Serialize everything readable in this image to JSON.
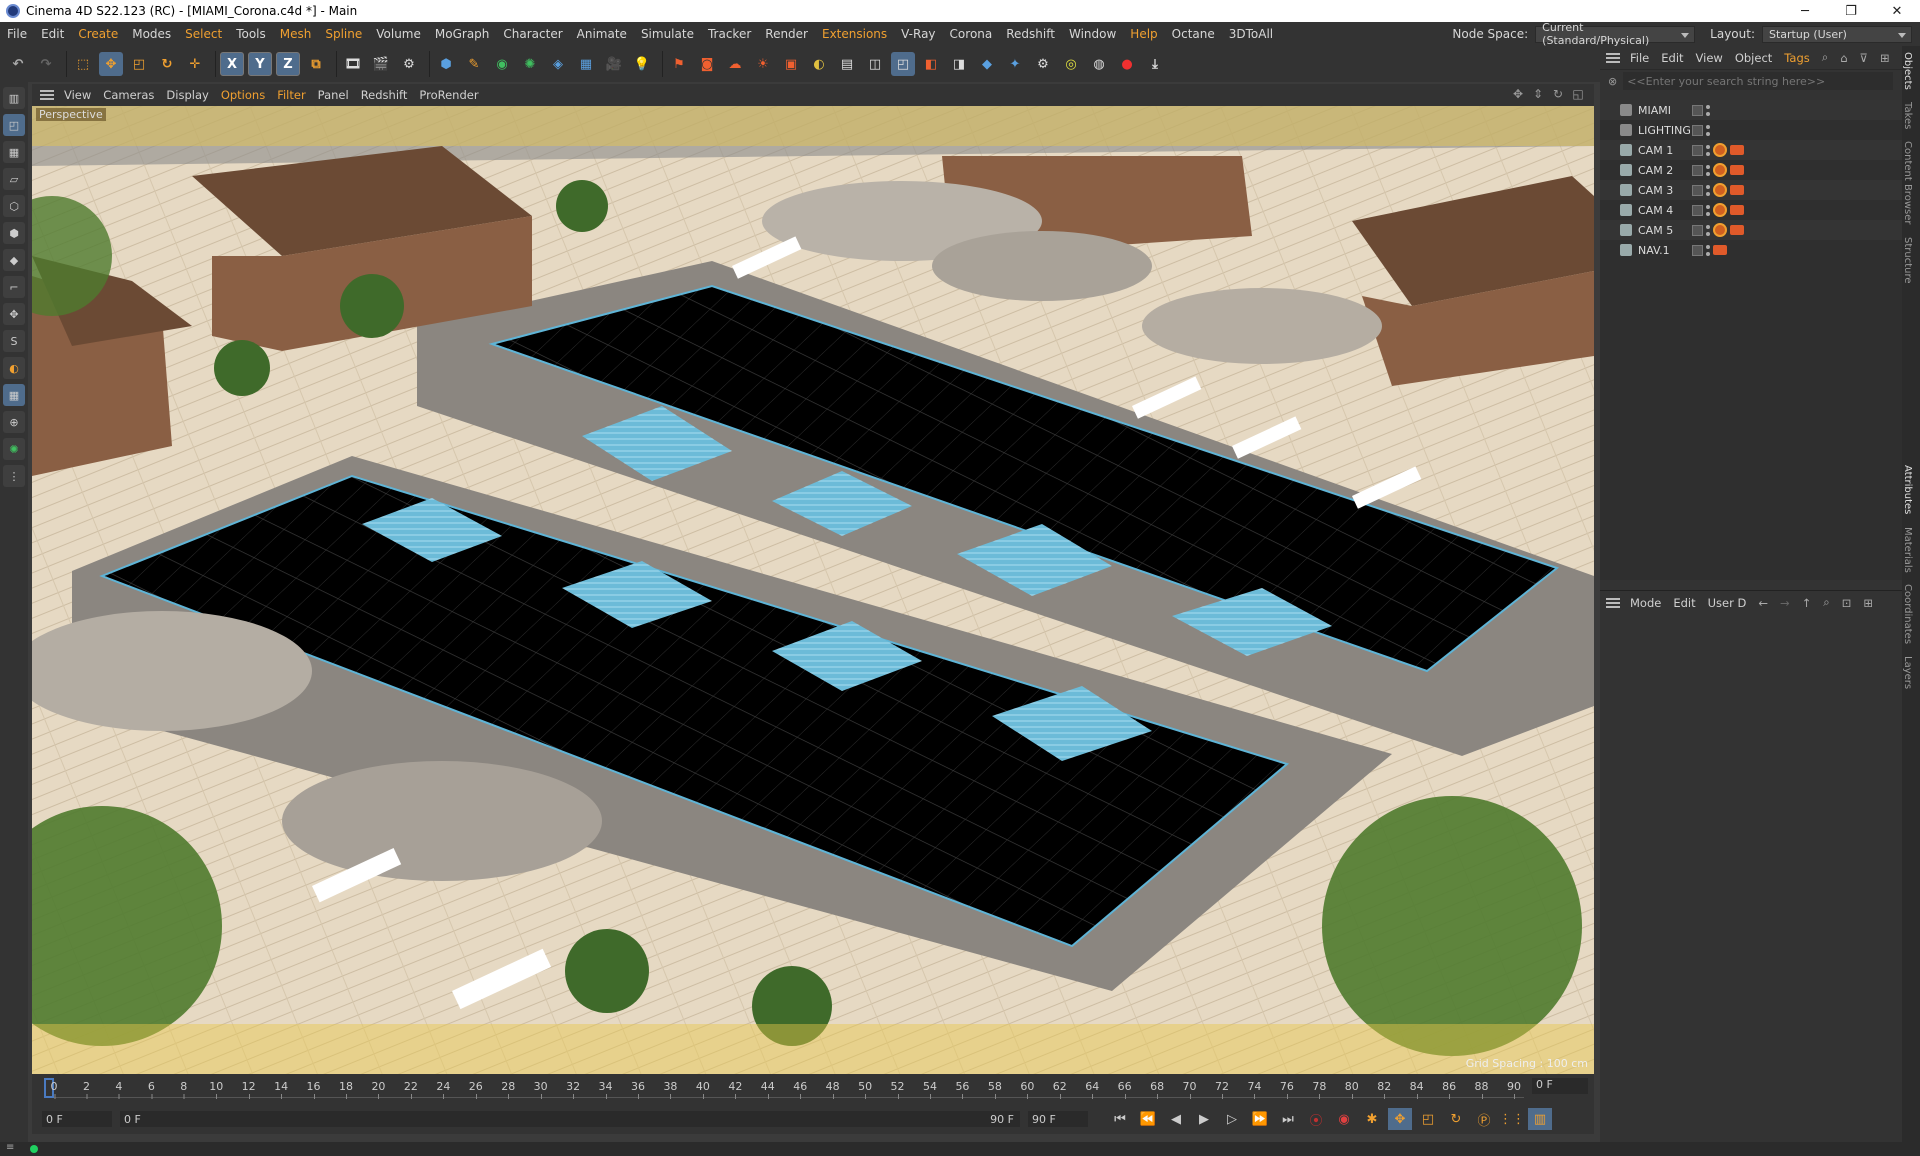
{
  "window": {
    "title": "Cinema 4D S22.123 (RC) - [MIAMI_Corona.c4d *] - Main"
  },
  "menu": {
    "items": [
      "File",
      "Edit",
      "Create",
      "Modes",
      "Select",
      "Tools",
      "Mesh",
      "Spline",
      "Volume",
      "MoGraph",
      "Character",
      "Animate",
      "Simulate",
      "Tracker",
      "Render",
      "Extensions",
      "V-Ray",
      "Corona",
      "Redshift",
      "Window",
      "Help",
      "Octane",
      "3DToAll"
    ],
    "node_space_label": "Node Space:",
    "node_space_value": "Current (Standard/Physical)",
    "layout_label": "Layout:",
    "layout_value": "Startup (User)"
  },
  "toolbar": {
    "x_label": "X",
    "y_label": "Y",
    "z_label": "Z"
  },
  "viewport": {
    "menu": [
      "View",
      "Cameras",
      "Display",
      "Options",
      "Filter",
      "Panel",
      "Redshift",
      "ProRender"
    ],
    "label": "Perspective",
    "grid_spacing": "Grid Spacing : 100 cm"
  },
  "objects_panel": {
    "menu": [
      "File",
      "Edit",
      "View",
      "Object",
      "Tags"
    ],
    "search_placeholder": "<<Enter your search string here>>",
    "objects": [
      "MIAMI",
      "LIGHTING",
      "CAM 1",
      "CAM 2",
      "CAM 3",
      "CAM 4",
      "CAM 5",
      "NAV.1"
    ]
  },
  "attributes_panel": {
    "menu": [
      "Mode",
      "Edit",
      "User D"
    ]
  },
  "side_tabs": [
    "Objects",
    "Takes",
    "Content Browser",
    "Structure",
    "Attributes",
    "Materials",
    "Coordinates",
    "Layers"
  ],
  "timeline": {
    "ticks": [
      "0",
      "2",
      "4",
      "6",
      "8",
      "10",
      "12",
      "14",
      "16",
      "18",
      "20",
      "22",
      "24",
      "26",
      "28",
      "30",
      "32",
      "34",
      "36",
      "38",
      "40",
      "42",
      "44",
      "46",
      "48",
      "50",
      "52",
      "54",
      "56",
      "58",
      "60",
      "62",
      "64",
      "66",
      "68",
      "70",
      "72",
      "74",
      "76",
      "78",
      "80",
      "82",
      "84",
      "86",
      "88",
      "90"
    ],
    "current_frame": "0 F",
    "start_frame": "0 F",
    "min_frame": "0 F",
    "max_frame": "90 F",
    "end_frame": "90 F"
  },
  "colors": {
    "accent": "#f0a030",
    "selection": "#4f6c8c",
    "pool_water": "#5fb4d6",
    "pool_tile": "#000000",
    "status_ok": "#20d060"
  }
}
